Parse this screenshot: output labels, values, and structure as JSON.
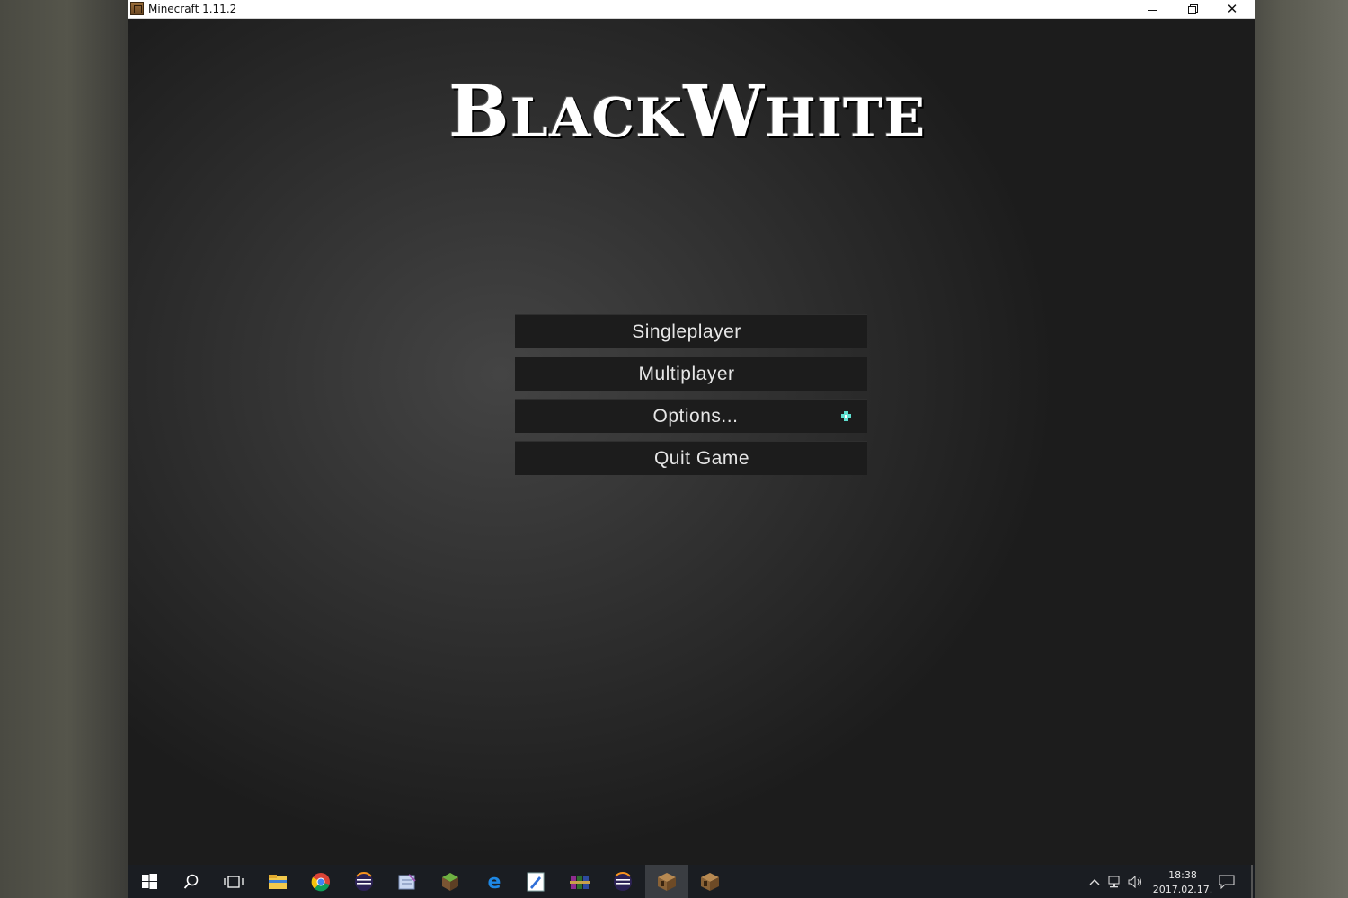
{
  "window": {
    "title": "Minecraft 1.11.2",
    "controls": {
      "minimize": "minimize-icon",
      "restore": "restore-icon",
      "close": "close-icon"
    }
  },
  "game": {
    "logo": {
      "part1_initial": "B",
      "part1_rest": "LACK",
      "part2_initial": "W",
      "part2_rest": "HITE"
    },
    "menu": {
      "singleplayer": "Singleplayer",
      "multiplayer": "Multiplayer",
      "options": "Options...",
      "quit": "Quit Game"
    },
    "cursor_color": "#5fe0d0"
  },
  "taskbar": {
    "icons": [
      "windows-start-icon",
      "search-icon",
      "task-view-icon",
      "file-explorer-icon",
      "chrome-icon",
      "eclipse-icon",
      "notepad-icon",
      "minecraft-grass-icon",
      "edge-icon",
      "paint-icon",
      "winrar-icon",
      "eclipse-icon",
      "minecraft-launcher-icon",
      "minecraft-launcher-icon"
    ],
    "tray": {
      "time": "18:38",
      "date": "2017.02.17."
    }
  }
}
